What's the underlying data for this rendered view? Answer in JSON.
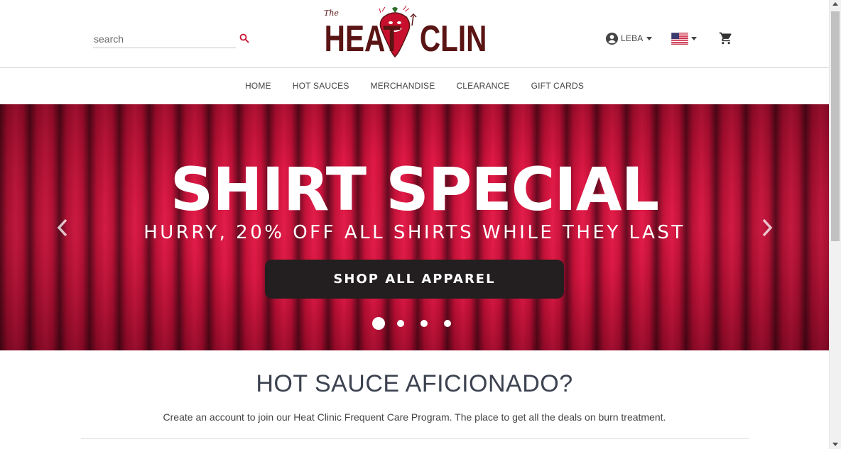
{
  "header": {
    "search": {
      "placeholder": "search",
      "value": ""
    },
    "logo": {
      "small_word": "The",
      "word_left": "HEAT",
      "word_right": "CLINIC"
    },
    "account": {
      "label": "LEBA"
    },
    "cart": {}
  },
  "nav": {
    "items": [
      {
        "label": "HOME"
      },
      {
        "label": "HOT SAUCES"
      },
      {
        "label": "MERCHANDISE"
      },
      {
        "label": "CLEARANCE"
      },
      {
        "label": "GIFT CARDS"
      }
    ]
  },
  "hero": {
    "title": "SHIRT SPECIAL",
    "subtitle": "HURRY, 20% OFF ALL SHIRTS WHILE THEY LAST",
    "cta": "SHOP ALL APPAREL",
    "slide_count": 4,
    "active_slide": 1
  },
  "content": {
    "title": "HOT SAUCE AFICIONADO?",
    "text": "Create an account to join our Heat Clinic Frequent Care Program. The place to get all the deals on burn treatment."
  },
  "colors": {
    "brand_red": "#c8102e",
    "logo_dark": "#5a1414",
    "cta_bg": "#231f20"
  },
  "icons": [
    "search-icon",
    "account-circle-icon",
    "us-flag-icon",
    "cart-icon",
    "chevron-left-icon",
    "chevron-right-icon"
  ]
}
